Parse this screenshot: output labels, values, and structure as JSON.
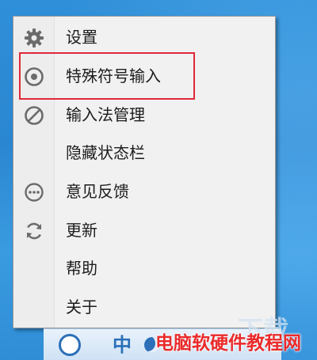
{
  "menu": {
    "items": [
      {
        "label": "设置",
        "icon": "gear-icon"
      },
      {
        "label": "特殊符号输入",
        "icon": "target-circle-icon"
      },
      {
        "label": "输入法管理",
        "icon": "slash-circle-icon"
      },
      {
        "label": "隐藏状态栏",
        "icon": ""
      },
      {
        "label": "意见反馈",
        "icon": "ellipsis-circle-icon"
      },
      {
        "label": "更新",
        "icon": "refresh-icon"
      },
      {
        "label": "帮助",
        "icon": ""
      },
      {
        "label": "关于",
        "icon": ""
      }
    ],
    "highlighted_item": "特殊符号输入"
  },
  "taskbar": {
    "ime_mode_label": "中"
  },
  "watermark": {
    "text": "电脑软硬件教程网",
    "ghost_text": "下载"
  },
  "colors": {
    "menu_bg": "#f1f1f1",
    "highlight_border": "#e0283a",
    "icon_gray": "#6b6b6b",
    "watermark_red": "#ea2b2b",
    "taskbar_blue": "#2b6fb8"
  }
}
